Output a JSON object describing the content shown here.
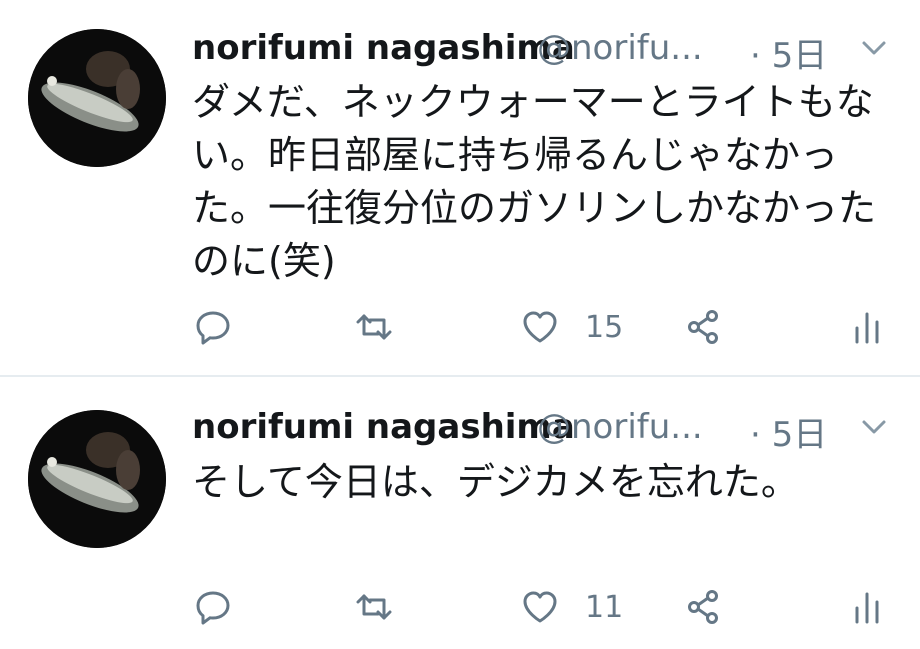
{
  "tweets": [
    {
      "author_name": "norifumi nagashima",
      "handle": "@norifu...",
      "time": "· 5日",
      "text": "ダメだ、ネックウォーマーとライトもない。昨日部屋に持ち帰るんじゃなかった。一往復分位のガソリンしかなかったのに(笑)",
      "likes": "15",
      "icons": [
        "reply-icon",
        "retweet-icon",
        "heart-icon",
        "share-icon",
        "stats-icon",
        "chevron-down-icon"
      ]
    },
    {
      "author_name": "norifumi nagashima",
      "handle": "@norifu...",
      "time": "· 5日",
      "text": "そして今日は、デジカメを忘れた。",
      "likes": "11",
      "icons": [
        "reply-icon",
        "retweet-icon",
        "heart-icon",
        "share-icon",
        "stats-icon",
        "chevron-down-icon"
      ]
    }
  ],
  "colors": {
    "text": "#14171a",
    "secondary": "#657786",
    "divider": "#e6ecf0",
    "background": "#ffffff"
  }
}
